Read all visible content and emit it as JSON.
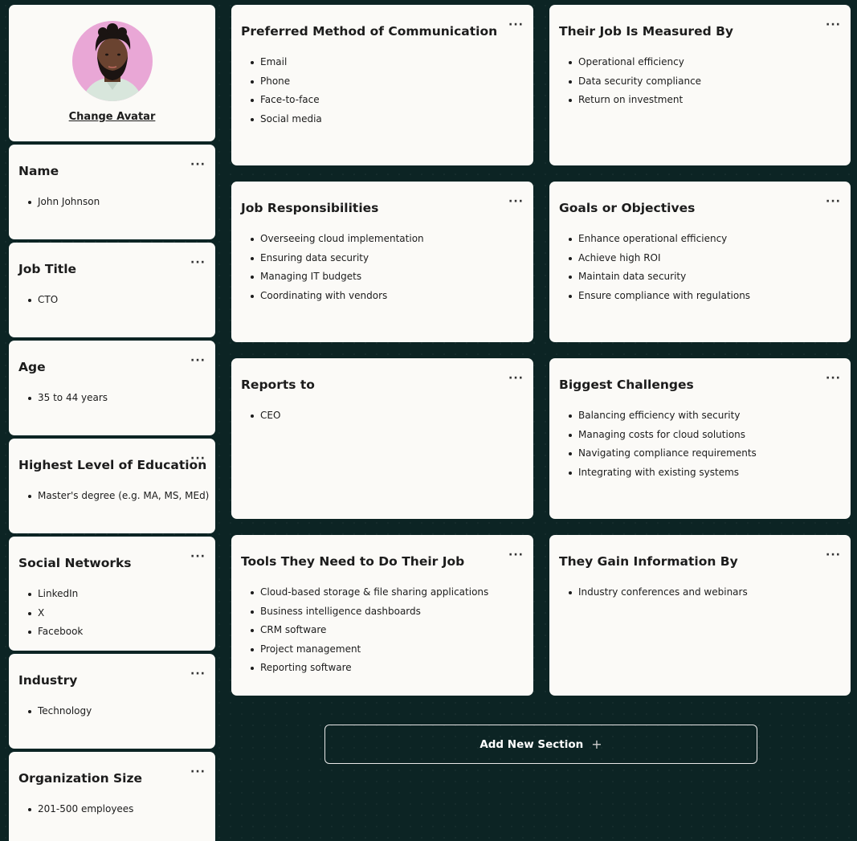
{
  "profile": {
    "change_avatar_label": "Change Avatar"
  },
  "left_cards": [
    {
      "title": "Name",
      "items": [
        "John Johnson"
      ]
    },
    {
      "title": "Job Title",
      "items": [
        "CTO"
      ]
    },
    {
      "title": "Age",
      "items": [
        "35 to 44 years"
      ]
    },
    {
      "title": "Highest Level of Education",
      "items": [
        "Master's degree (e.g. MA, MS, MEd)"
      ]
    },
    {
      "title": "Social Networks",
      "items": [
        "LinkedIn",
        "X",
        "Facebook"
      ]
    },
    {
      "title": "Industry",
      "items": [
        "Technology"
      ]
    },
    {
      "title": "Organization Size",
      "items": [
        "201-500 employees"
      ]
    }
  ],
  "main_cards": [
    {
      "title": "Preferred Method of Communication",
      "items": [
        "Email",
        "Phone",
        "Face-to-face",
        "Social media"
      ]
    },
    {
      "title": "Their Job Is Measured By",
      "items": [
        "Operational efficiency",
        "Data security compliance",
        "Return on investment"
      ]
    },
    {
      "title": "Job Responsibilities",
      "items": [
        "Overseeing cloud implementation",
        "Ensuring data security",
        "Managing IT budgets",
        "Coordinating with vendors"
      ]
    },
    {
      "title": "Goals or Objectives",
      "items": [
        "Enhance operational efficiency",
        "Achieve high ROI",
        "Maintain data security",
        "Ensure compliance with regulations"
      ]
    },
    {
      "title": "Reports to",
      "items": [
        "CEO"
      ]
    },
    {
      "title": "Biggest Challenges",
      "items": [
        "Balancing efficiency with security",
        "Managing costs for cloud solutions",
        "Navigating compliance requirements",
        "Integrating with existing systems"
      ]
    },
    {
      "title": "Tools They Need to Do Their Job",
      "items": [
        "Cloud-based storage & file sharing applications",
        "Business intelligence dashboards",
        "CRM software",
        "Project management",
        "Reporting software"
      ]
    },
    {
      "title": "They Gain Information By",
      "items": [
        "Industry conferences and webinars"
      ]
    }
  ],
  "menu_icon": "ellipsis-icon",
  "add_section": {
    "label": "Add New Section",
    "icon": "+"
  },
  "colors": {
    "background": "#0c2424",
    "card": "#fbfaf7",
    "avatar_bg": "#e9a7d6"
  }
}
